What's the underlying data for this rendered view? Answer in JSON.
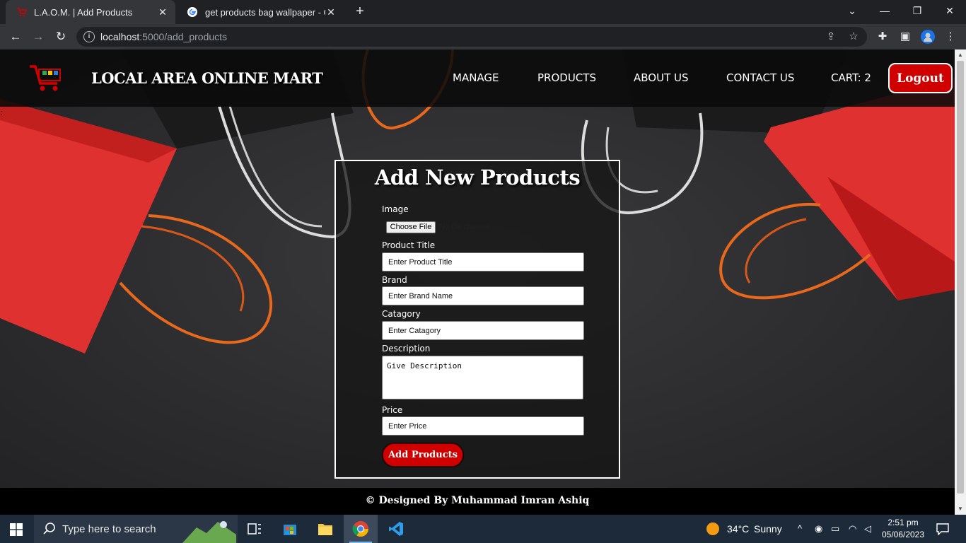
{
  "browser": {
    "tabs": [
      {
        "title": "L.A.O.M. | Add Products",
        "active": true,
        "favicon": "cart-favicon-icon"
      },
      {
        "title": "get products bag wallpaper - Goo",
        "active": false,
        "favicon": "google-g-icon"
      }
    ],
    "new_tab": "+",
    "url_host": "localhost",
    "url_rest": ":5000/add_products",
    "window_controls": {
      "tab_search": "⌄",
      "minimize": "—",
      "restore": "❐",
      "close": "✕"
    }
  },
  "site": {
    "brand": "LOCAL AREA ONLINE MART",
    "nav": {
      "manage": "MANAGE",
      "products": "PRODUCTS",
      "about": "ABOUT US",
      "contact": "CONTACT US",
      "cart": "CART: 2"
    },
    "logout": "Logout",
    "stray_mark": ";"
  },
  "form": {
    "title": "Add New Products",
    "image_label": "Image",
    "file_button": "Choose File",
    "file_status": "No file chosen",
    "title_label": "Product Title",
    "title_placeholder": "Enter Product Title",
    "brand_label": "Brand",
    "brand_placeholder": "Enter Brand Name",
    "category_label": "Catagory",
    "category_placeholder": "Enter Catagory",
    "description_label": "Description",
    "description_placeholder": "Give Description",
    "price_label": "Price",
    "price_placeholder": "Enter Price",
    "submit": "Add Products"
  },
  "footer": {
    "credit": "© Designed By Muhammad Imran Ashiq"
  },
  "taskbar": {
    "search_placeholder": "Type here to search",
    "weather_temp": "34°C",
    "weather_desc": "Sunny",
    "time": "2:51 pm",
    "date": "05/06/2023"
  },
  "colors": {
    "accent_red": "#d00000",
    "header_bg": "#0a0a0a",
    "chrome_bg": "#202124",
    "taskbar_bg": "#1c2a3a"
  }
}
